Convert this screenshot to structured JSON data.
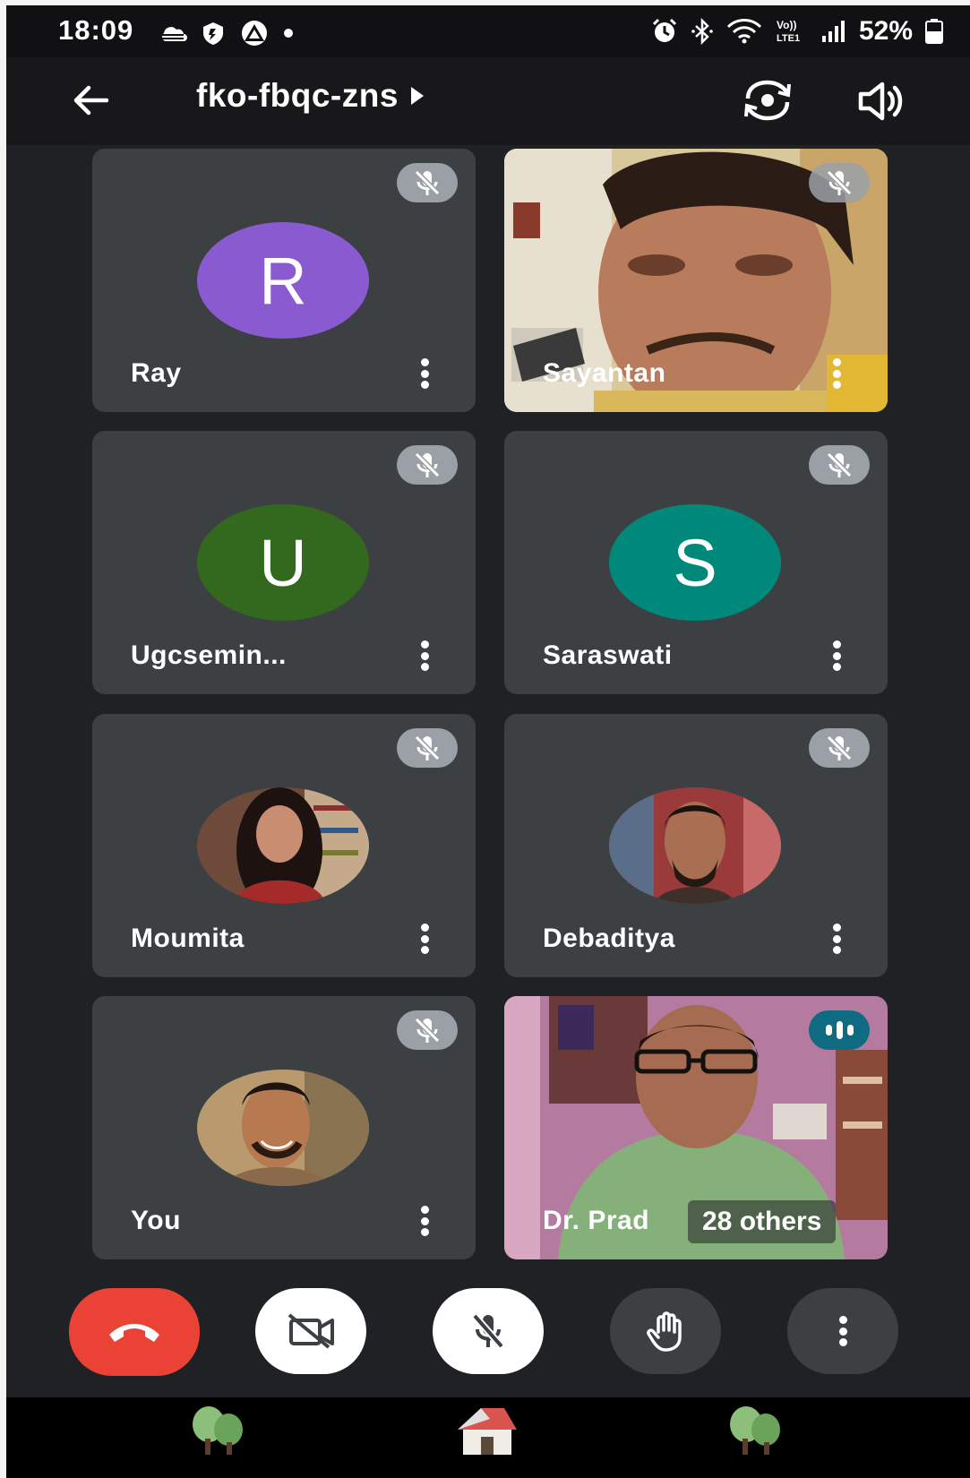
{
  "status_bar": {
    "time": "18:09",
    "battery_text": "52%",
    "icons": [
      "cloud-icon",
      "shield-icon",
      "arrow-up-icon",
      "dot-icon",
      "alarm-icon",
      "bluetooth-icon",
      "wifi-icon",
      "volte-icon",
      "signal-icon",
      "battery-icon"
    ]
  },
  "app_bar": {
    "meeting_code": "fko-fbqc-zns",
    "icons": [
      "back-arrow-icon",
      "chevron-right-icon",
      "flip-camera-icon",
      "speaker-icon"
    ]
  },
  "participants": [
    {
      "name": "Ray",
      "initial": "R",
      "avatar_color": "#8a5ad0",
      "muted": true,
      "type": "letter"
    },
    {
      "name": "Sayantan",
      "muted": true,
      "type": "video"
    },
    {
      "name": "Ugcsemin...",
      "initial": "U",
      "avatar_color": "#33691e",
      "muted": true,
      "type": "letter"
    },
    {
      "name": "Saraswati",
      "initial": "S",
      "avatar_color": "#00897b",
      "muted": true,
      "type": "letter"
    },
    {
      "name": "Moumita",
      "muted": true,
      "type": "photo"
    },
    {
      "name": "Debaditya",
      "muted": true,
      "type": "photo"
    },
    {
      "name": "You",
      "muted": true,
      "type": "photo"
    },
    {
      "name": "Dr. Prad",
      "muted": false,
      "speaking": true,
      "type": "video"
    }
  ],
  "others_label": "28 others",
  "controls": {
    "end_call_color": "#ea4335",
    "icons": [
      "end-call-icon",
      "camera-off-icon",
      "mic-off-icon",
      "raise-hand-icon",
      "more-options-icon"
    ]
  },
  "nav_bar": {
    "icons": [
      "trees-icon",
      "home-icon",
      "trees-icon"
    ]
  }
}
